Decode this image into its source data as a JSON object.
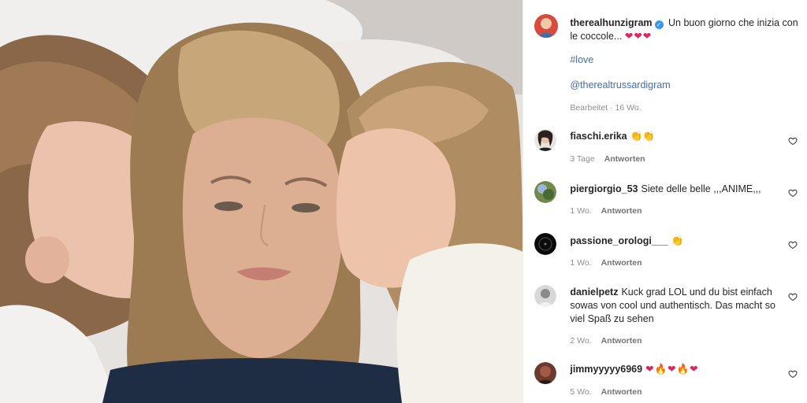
{
  "post": {
    "author": "therealhunzigram",
    "caption": "Un buon giorno che inizia con le coccole...",
    "caption_emojis": "❤❤❤",
    "hashtag": "#love",
    "mention": "@therealtrussardigram",
    "meta": "Bearbeitet · 16 Wo."
  },
  "comments": [
    {
      "user": "fiaschi.erika",
      "text": "👏👏",
      "age": "3 Tage",
      "reply": "Antworten"
    },
    {
      "user": "piergiorgio_53",
      "text": "Siete delle belle ,,,ANIME,,,",
      "age": "1 Wo.",
      "reply": "Antworten"
    },
    {
      "user": "passione_orologi___",
      "text": "👏",
      "age": "1 Wo.",
      "reply": "Antworten"
    },
    {
      "user": "danielpetz",
      "text": "Kuck grad LOL und du bist einfach sowas von cool und authentisch. Das macht so viel Spaß zu sehen",
      "age": "2 Wo.",
      "reply": "Antworten"
    },
    {
      "user": "jimmyyyyy6969",
      "text": "❤🔥❤🔥❤",
      "age": "5 Wo.",
      "reply": "Antworten"
    }
  ],
  "icons": {
    "verified": "verified-badge-icon",
    "like": "heart-outline-icon"
  },
  "colors": {
    "link": "#3b6fb6",
    "verified": "#3897f0",
    "heart": "#e0245e"
  }
}
